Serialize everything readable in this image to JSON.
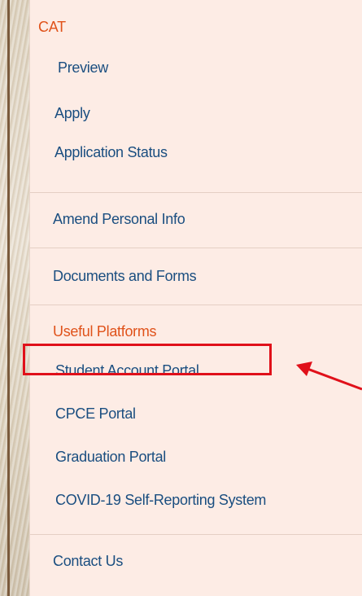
{
  "menu": {
    "cat_section": {
      "heading": "CAT",
      "items": [
        {
          "label": "Preview"
        },
        {
          "label": "Apply"
        },
        {
          "label": "Application Status"
        }
      ]
    },
    "amend_personal_info": "Amend Personal Info",
    "documents_and_forms": "Documents and Forms",
    "useful_platforms": {
      "heading": "Useful Platforms",
      "items": [
        {
          "label": "Student Account Portal",
          "highlighted": true
        },
        {
          "label": "CPCE Portal"
        },
        {
          "label": "Graduation Portal"
        },
        {
          "label": "COVID-19 Self-Reporting System"
        }
      ]
    },
    "contact_us": "Contact Us"
  },
  "annotation": {
    "highlight_color": "#e0101a",
    "arrow_color": "#e0101a"
  },
  "colors": {
    "menu_background": "#fdece5",
    "link": "#1a4e80",
    "section_heading": "#e0521a",
    "separator": "#e4cfc4"
  }
}
